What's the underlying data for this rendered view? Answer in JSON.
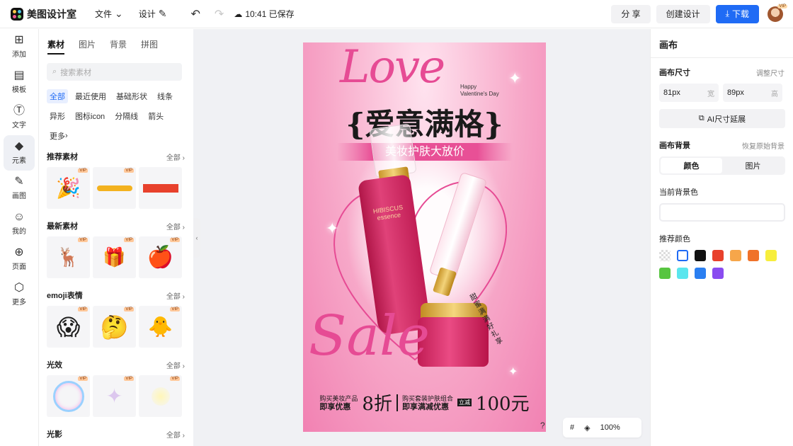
{
  "app": {
    "name": "美图设计室"
  },
  "topbar": {
    "file_label": "文件",
    "design_label": "设计",
    "save_status": "10:41 已保存",
    "share_label": "分 享",
    "create_label": "创建设计",
    "download_label": "下载",
    "vip_badge": "VIP"
  },
  "rail": [
    {
      "label": "添加",
      "icon": "plus-square-icon"
    },
    {
      "label": "模板",
      "icon": "template-icon"
    },
    {
      "label": "文字",
      "icon": "text-icon"
    },
    {
      "label": "元素",
      "icon": "shapes-icon"
    },
    {
      "label": "画图",
      "icon": "pencil-icon"
    },
    {
      "label": "我的",
      "icon": "user-icon"
    },
    {
      "label": "页面",
      "icon": "page-add-icon"
    },
    {
      "label": "更多",
      "icon": "cube-icon"
    }
  ],
  "panel": {
    "tabs": [
      "素材",
      "图片",
      "背景",
      "拼图"
    ],
    "search_placeholder": "搜索素材",
    "chips": [
      "全部",
      "最近使用",
      "基础形状",
      "线条",
      "异形",
      "图标icon",
      "分隔线",
      "箭头",
      "更多"
    ],
    "all_label": "全部",
    "vip": "VIP",
    "sections": [
      {
        "title": "推荐素材"
      },
      {
        "title": "最新素材"
      },
      {
        "title": "emoji表情"
      },
      {
        "title": "光效"
      },
      {
        "title": "光影"
      }
    ]
  },
  "poster": {
    "love": "Love",
    "happy_line1": "Happy",
    "happy_line2": "Valentine's Day",
    "headline": "{爱意满格}",
    "subline": "美妆护肤大放价",
    "sale": "Sale",
    "vertical_text": "甜蜜满满好礼享",
    "offer1_small": "购买美妆产品",
    "offer1_label": "即享优惠",
    "offer1_value": "8折",
    "offer2_small": "购买套装护肤组合",
    "offer2_label": "即享满减优惠",
    "offer2_tag": "立减",
    "offer2_value": "100元",
    "bottle_brand": "HIBISCUS",
    "bottle_sub": "essence"
  },
  "zoom": {
    "help": "?",
    "value": "100%"
  },
  "rpanel": {
    "title": "画布",
    "size_label": "画布尺寸",
    "size_adjust": "调整尺寸",
    "width_value": "81px",
    "width_unit": "宽",
    "height_value": "89px",
    "height_unit": "高",
    "ai_label": "AI尺寸延展",
    "bg_label": "画布背景",
    "bg_restore": "恢复原始背景",
    "seg_color": "颜色",
    "seg_image": "图片",
    "current_bg_label": "当前背景色",
    "recommend_label": "推荐颜色",
    "swatches": [
      "transparent",
      "#ffffff",
      "#111111",
      "#e8412c",
      "#f6a64a",
      "#f0722a",
      "#f7ee3c",
      "#57c540",
      "#5ae6ee",
      "#2b7ff1",
      "#8a4cf0"
    ]
  },
  "colors": {
    "accent": "#1f6bf5",
    "poster_pink": "#e64b94"
  }
}
